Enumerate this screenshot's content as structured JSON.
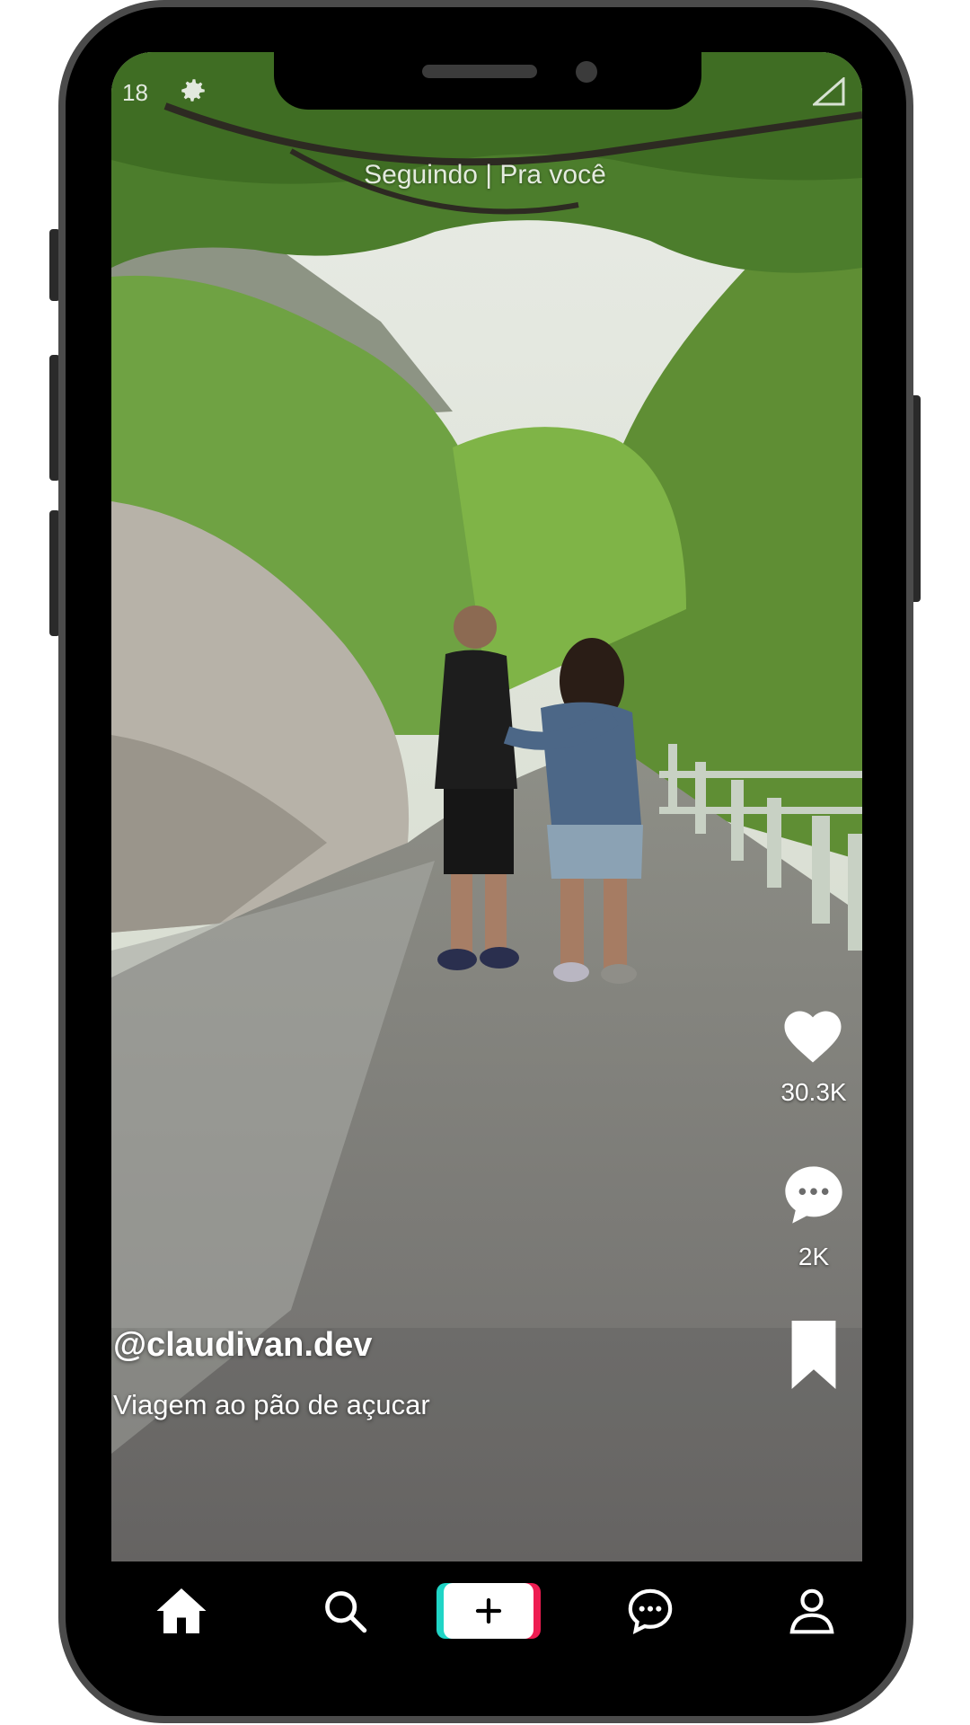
{
  "status_bar": {
    "time": "18"
  },
  "feed_tabs": {
    "label": "Seguindo | Pra você"
  },
  "actions": {
    "like_count": "30.3K",
    "comment_count": "2K"
  },
  "post": {
    "username": "@claudivan.dev",
    "caption": "Viagem ao pão de açucar"
  },
  "bottom_nav": {
    "items": [
      "home",
      "search",
      "create",
      "inbox",
      "profile"
    ],
    "create_colors": {
      "left": "#20d5c6",
      "right": "#ee1d52"
    }
  },
  "icons": {
    "status": [
      "gear-icon",
      "signal-icon"
    ],
    "rail": [
      "heart-icon",
      "comment-icon",
      "bookmark-icon"
    ],
    "nav": [
      "home-icon",
      "search-icon",
      "plus-icon",
      "message-icon",
      "user-icon"
    ]
  }
}
